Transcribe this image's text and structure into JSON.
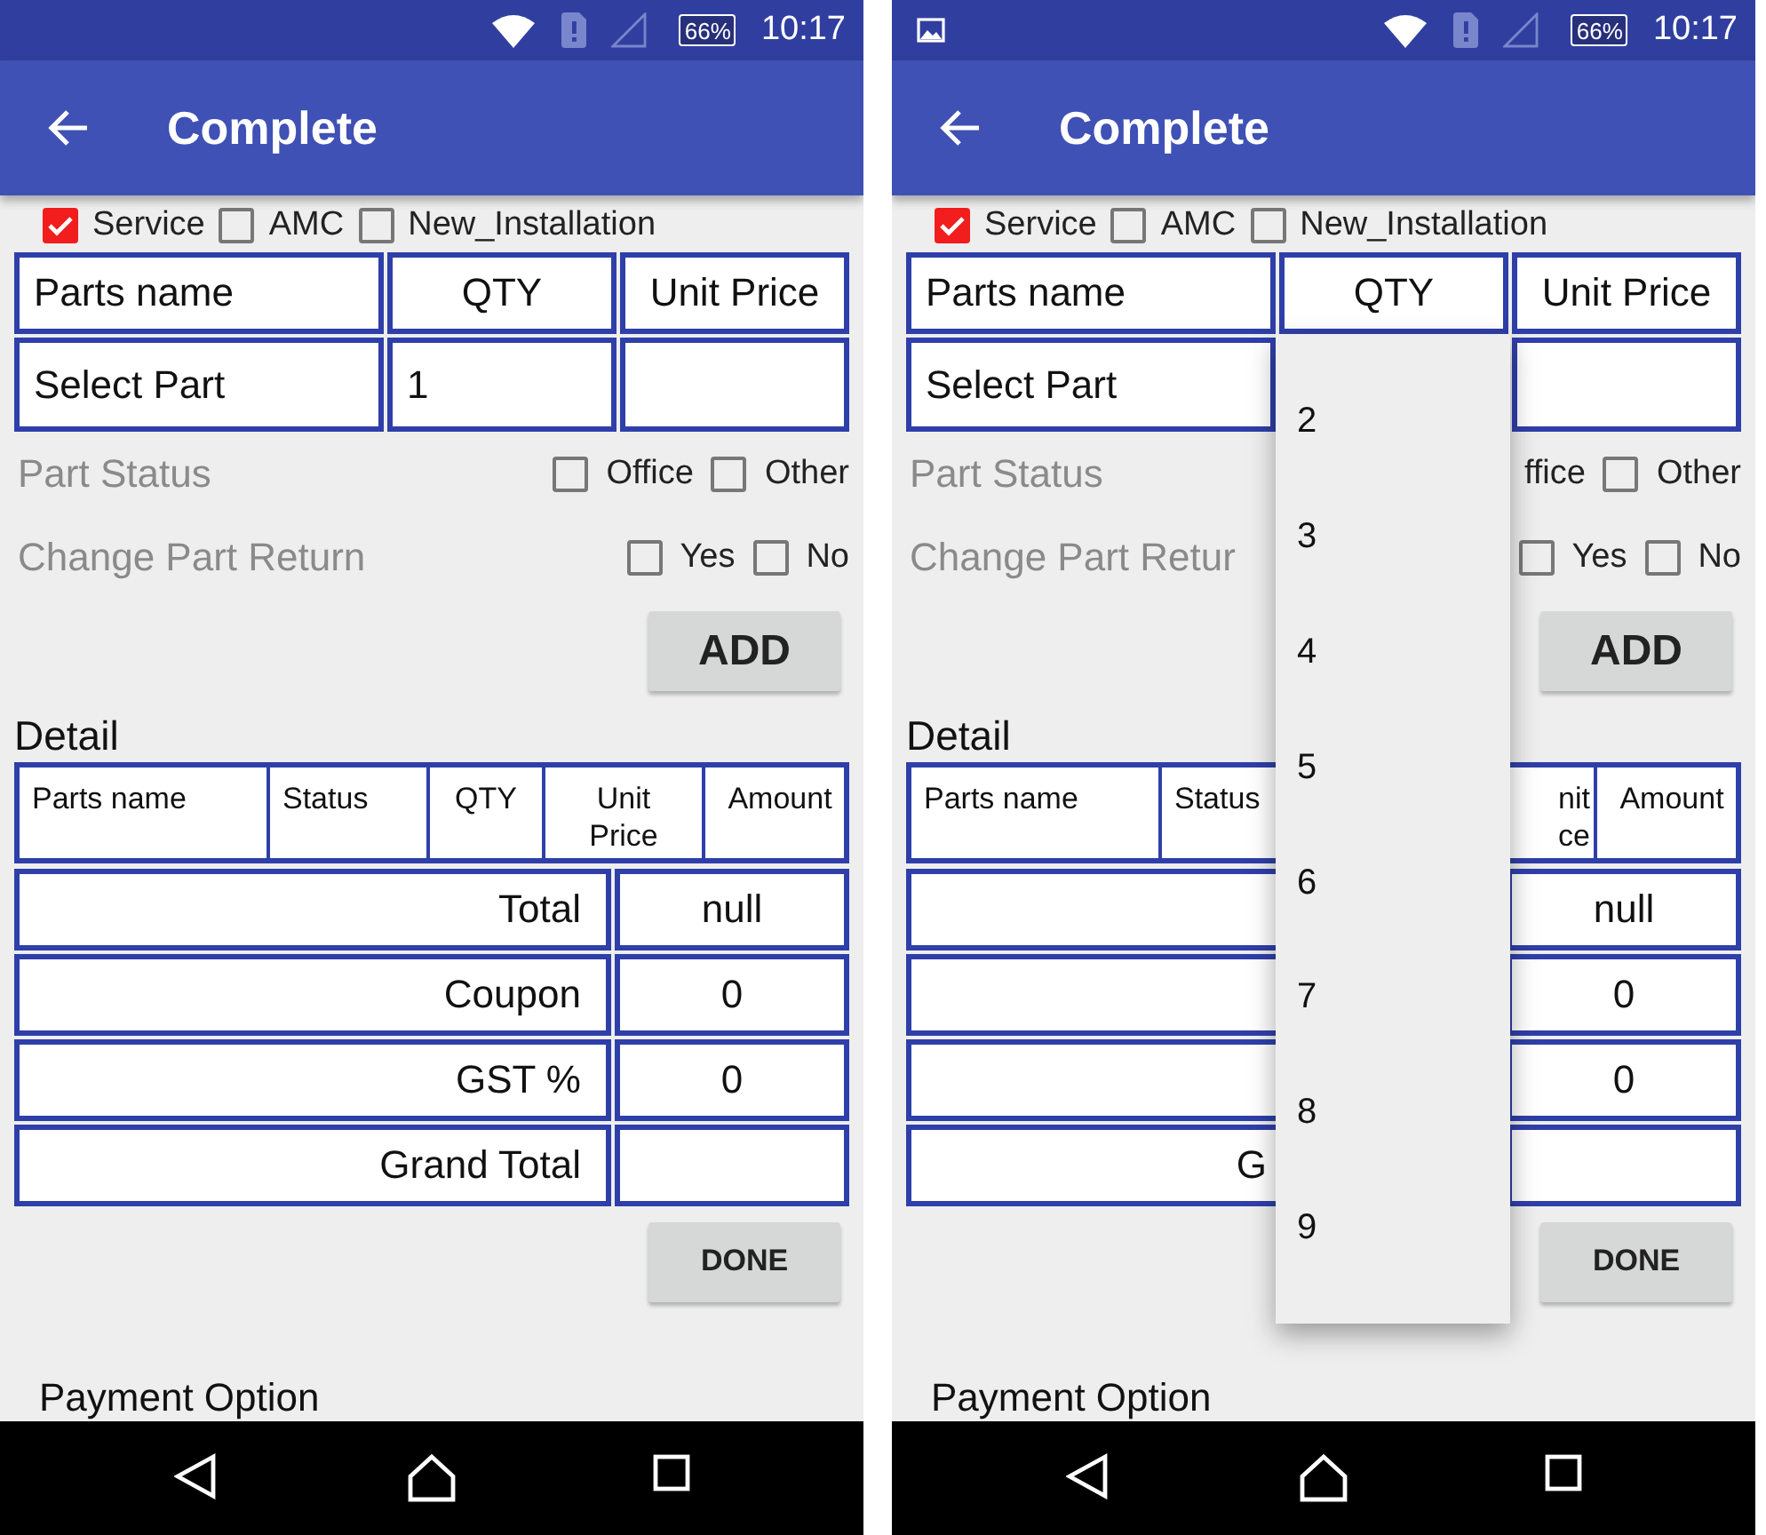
{
  "screens": [
    {
      "status_bar": {
        "notification": false,
        "battery": "66%",
        "time": "10:17"
      },
      "app_bar": {
        "title": "Complete"
      },
      "job_types": [
        {
          "label": "Service",
          "checked": true
        },
        {
          "label": "AMC",
          "checked": false
        },
        {
          "label": "New_Installation",
          "checked": false
        }
      ],
      "parts_table": {
        "columns": [
          "Parts name",
          "QTY",
          "Unit Price"
        ],
        "part": "Select Part",
        "qty": "1"
      },
      "option_rows": [
        {
          "label": "Part Status",
          "options": [
            {
              "label": "Office",
              "checked": false
            },
            {
              "label": "Other",
              "checked": false
            }
          ]
        },
        {
          "label": "Change Part Return",
          "options": [
            {
              "label": "Yes",
              "checked": false
            },
            {
              "label": "No",
              "checked": false
            }
          ]
        }
      ],
      "add_button": "ADD",
      "detail": {
        "title": "Detail",
        "columns": [
          {
            "lines": [
              "Parts name"
            ]
          },
          {
            "lines": [
              "Status"
            ]
          },
          {
            "lines": [
              "QTY"
            ]
          },
          {
            "lines": [
              "Unit",
              "Price"
            ],
            "covered": false
          },
          {
            "lines": [
              "Amount"
            ]
          }
        ],
        "totals": [
          {
            "label": "Total",
            "value": "null"
          },
          {
            "label": "Coupon",
            "value": "0"
          },
          {
            "label": "GST %",
            "value": "0"
          },
          {
            "label": "Grand Total"
          }
        ]
      },
      "done_button": "DONE",
      "payment_title": "Payment Option"
    },
    {
      "status_bar": {
        "notification": true,
        "battery": "66%",
        "time": "10:17"
      },
      "app_bar": {
        "title": "Complete"
      },
      "job_types": [
        {
          "label": "Service",
          "checked": true
        },
        {
          "label": "AMC",
          "checked": false
        },
        {
          "label": "New_Installation",
          "checked": false
        }
      ],
      "parts_table": {
        "columns": [
          "Parts name",
          "QTY",
          "Unit Price"
        ],
        "part": "Select Part"
      },
      "option_rows": [
        {
          "label": "Part Status",
          "options": [
            {
              "label": "ffice"
            },
            {
              "label": "Other",
              "checked": false
            }
          ]
        },
        {
          "label": "Change Part Retur",
          "options": [
            {
              "label": "Yes",
              "checked": false
            },
            {
              "label": "No",
              "checked": false
            }
          ]
        }
      ],
      "add_button": "ADD",
      "detail": {
        "title": "Detail",
        "columns": [
          {
            "lines": [
              "Parts name"
            ]
          },
          {
            "lines": [
              "Status"
            ]
          },
          null,
          {
            "lines": [
              "nit",
              "ce"
            ],
            "covered": true
          },
          {
            "lines": [
              "Amount"
            ]
          }
        ],
        "totals": [
          {
            "value": "null"
          },
          {
            "value": "0"
          },
          {
            "value": "0"
          },
          {
            "label": "G"
          }
        ]
      },
      "done_button": "DONE",
      "payment_title": "Payment Option",
      "qty_dropdown": {
        "options": [
          "2",
          "3",
          "4",
          "5",
          "6",
          "7",
          "8",
          "9"
        ]
      }
    }
  ]
}
